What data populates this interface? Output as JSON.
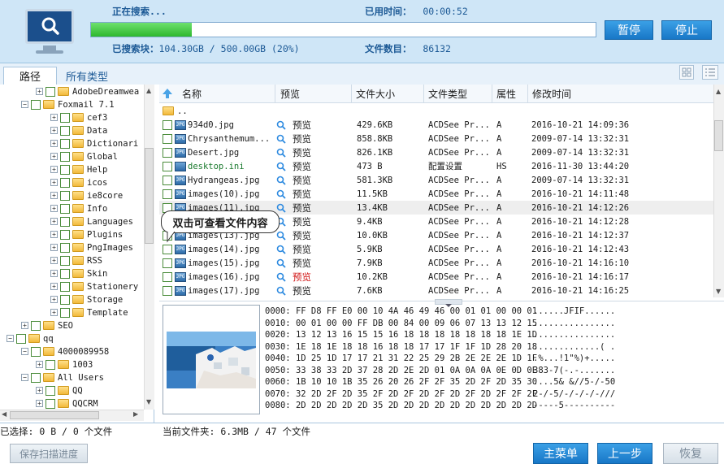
{
  "search": {
    "status_label": "正在搜索...",
    "elapsed_label": "用时间：",
    "elapsed_prefix": "已",
    "elapsed_value": "00:00:52",
    "searched_blocks_label": "已搜索块：",
    "searched_blocks_value": "104.30GB / 500.00GB (20%)",
    "file_count_label": "文件数目：",
    "file_count_value": "86132",
    "progress_percent": 20,
    "pause_label": "暂停",
    "stop_label": "停止"
  },
  "tabs": {
    "path": "路径",
    "all_types": "所有类型"
  },
  "tree": [
    {
      "label": "AdobeDreamwea",
      "level": 2
    },
    {
      "label": "Foxmail 7.1",
      "level": 1
    },
    {
      "label": "cef3",
      "level": 3
    },
    {
      "label": "Data",
      "level": 3
    },
    {
      "label": "Dictionari",
      "level": 3
    },
    {
      "label": "Global",
      "level": 3
    },
    {
      "label": "Help",
      "level": 3
    },
    {
      "label": "icos",
      "level": 3
    },
    {
      "label": "ie8core",
      "level": 3
    },
    {
      "label": "Info",
      "level": 3
    },
    {
      "label": "Languages",
      "level": 3
    },
    {
      "label": "Plugins",
      "level": 3
    },
    {
      "label": "PngImages",
      "level": 3
    },
    {
      "label": "RSS",
      "level": 3
    },
    {
      "label": "Skin",
      "level": 3
    },
    {
      "label": "Stationery",
      "level": 3
    },
    {
      "label": "Storage",
      "level": 3
    },
    {
      "label": "Template",
      "level": 3
    },
    {
      "label": "SEO",
      "level": 1
    },
    {
      "label": "qq",
      "level": 0
    },
    {
      "label": "4000089958",
      "level": 1
    },
    {
      "label": "1003",
      "level": 2
    },
    {
      "label": "All Users",
      "level": 1
    },
    {
      "label": "QQ",
      "level": 2
    },
    {
      "label": "QQCRM",
      "level": 2
    }
  ],
  "columns": {
    "name": "名称",
    "preview": "预览",
    "size": "文件大小",
    "type": "文件类型",
    "attr": "属性",
    "mtime": "修改时间"
  },
  "parent_dir": "..",
  "files": [
    {
      "name": "934d0.jpg",
      "preview": "预览",
      "size": "429.6KB",
      "type": "ACDSee Pr...",
      "attr": "A",
      "mtime": "2016-10-21 14:09:36"
    },
    {
      "name": "Chrysanthemum...",
      "preview": "预览",
      "size": "858.8KB",
      "type": "ACDSee Pr...",
      "attr": "A",
      "mtime": "2009-07-14 13:32:31"
    },
    {
      "name": "Desert.jpg",
      "preview": "预览",
      "size": "826.1KB",
      "type": "ACDSee Pr...",
      "attr": "A",
      "mtime": "2009-07-14 13:32:31"
    },
    {
      "name": "desktop.ini",
      "preview": "预览",
      "size": "473 B",
      "type": "配置设置",
      "attr": "HS",
      "mtime": "2016-11-30 13:44:20"
    },
    {
      "name": "Hydrangeas.jpg",
      "preview": "预览",
      "size": "581.3KB",
      "type": "ACDSee Pr...",
      "attr": "A",
      "mtime": "2009-07-14 13:32:31"
    },
    {
      "name": "images(10).jpg",
      "preview": "预览",
      "size": "11.5KB",
      "type": "ACDSee Pr...",
      "attr": "A",
      "mtime": "2016-10-21 14:11:48"
    },
    {
      "name": "images(11).jpg",
      "preview": "预览",
      "size": "13.4KB",
      "type": "ACDSee Pr...",
      "attr": "A",
      "mtime": "2016-10-21 14:12:26"
    },
    {
      "name": "images(12).jpg",
      "preview": "预览",
      "size": "9.4KB",
      "type": "ACDSee Pr...",
      "attr": "A",
      "mtime": "2016-10-21 14:12:28"
    },
    {
      "name": "images(13).jpg",
      "preview": "预览",
      "size": "10.0KB",
      "type": "ACDSee Pr...",
      "attr": "A",
      "mtime": "2016-10-21 14:12:37"
    },
    {
      "name": "images(14).jpg",
      "preview": "预览",
      "size": "5.9KB",
      "type": "ACDSee Pr...",
      "attr": "A",
      "mtime": "2016-10-21 14:12:43"
    },
    {
      "name": "images(15).jpg",
      "preview": "预览",
      "size": "7.9KB",
      "type": "ACDSee Pr...",
      "attr": "A",
      "mtime": "2016-10-21 14:16:10"
    },
    {
      "name": "images(16).jpg",
      "preview": "预览",
      "size": "10.2KB",
      "type": "ACDSee Pr...",
      "attr": "A",
      "mtime": "2016-10-21 14:16:17"
    },
    {
      "name": "images(17).jpg",
      "preview": "预览",
      "size": "7.6KB",
      "type": "ACDSee Pr...",
      "attr": "A",
      "mtime": "2016-10-21 14:16:25"
    }
  ],
  "tooltip": "双击可查看文件内容",
  "hex": [
    {
      "off": "0000:",
      "bytes": "FF D8 FF E0 00 10 4A 46 49 46 00 01 01 00 00 01",
      "ascii": "......JFIF......"
    },
    {
      "off": "0010:",
      "bytes": "00 01 00 00 FF DB 00 84 00 09 06 07 13 13 12 15",
      "ascii": "................"
    },
    {
      "off": "0020:",
      "bytes": "13 12 13 16 15 15 16 18 18 18 18 18 18 18 1E 1D",
      "ascii": "................"
    },
    {
      "off": "0030:",
      "bytes": "1E 18 1E 18 18 16 18 18 17 17 1F 1F 1D 28 20 18",
      "ascii": ".............( ."
    },
    {
      "off": "0040:",
      "bytes": "1D 25 1D 17 17 21 31 22 25 29 2B 2E 2E 2E 1D 1F",
      "ascii": ".%...!1\"%)+....."
    },
    {
      "off": "0050:",
      "bytes": "33 38 33 2D 37 28 2D 2E 2D 01 0A 0A 0A 0E 0D 0E",
      "ascii": "383-7(-.-......."
    },
    {
      "off": "0060:",
      "bytes": "1B 10 10 1B 35 26 20 26 2F 2F 35 2D 2F 2D 35 30",
      "ascii": "....5& &//5-/-50"
    },
    {
      "off": "0070:",
      "bytes": "32 2D 2F 2D 35 2F 2D 2F 2D 2F 2D 2F 2D 2F 2F 2F",
      "ascii": "2-/-5/-/-/-/-///"
    },
    {
      "off": "0080:",
      "bytes": "2D 2D 2D 2D 2D 35 2D 2D 2D 2D 2D 2D 2D 2D 2D 2D",
      "ascii": "-----5----------"
    }
  ],
  "status": {
    "selected": "已选择: 0 B / 0 个文件",
    "current_folder": "当前文件夹: 6.3MB / 47 个文件"
  },
  "bottom": {
    "save_progress": "保存扫描进度",
    "main_menu": "主菜单",
    "prev_step": "上一步",
    "recover": "恢复"
  },
  "colors": {
    "accent": "#1877c7",
    "progress": "#2eb82e",
    "topbar": "#cfe6f7"
  }
}
